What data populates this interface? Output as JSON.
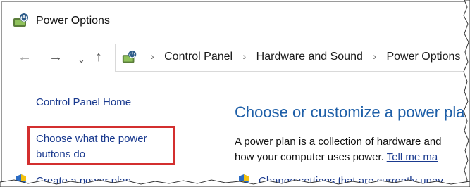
{
  "window": {
    "title": "Power Options",
    "app_icon": "power-options-icon"
  },
  "nav": {
    "back_icon": "back-arrow-icon",
    "forward_icon": "forward-arrow-icon",
    "recent_icon": "chevron-down-icon",
    "up_icon": "up-arrow-icon"
  },
  "address": {
    "crumbs": [
      "Control Panel",
      "Hardware and Sound",
      "Power Options"
    ]
  },
  "sidebar": {
    "home_link": "Control Panel Home",
    "power_buttons_link": "Choose what the power buttons do",
    "create_plan_link": "Create a power plan",
    "highlight_color": "#d32f2f"
  },
  "main": {
    "heading": "Choose or customize a power pla",
    "desc_line1": "A power plan is a collection of hardware and",
    "desc_line2": "how your computer uses power.",
    "tell_me_link": "Tell me ma",
    "change_settings_link": "Change settings that are currently unav"
  },
  "colors": {
    "link": "#1a3a8f",
    "heading": "#1e5fa8"
  }
}
